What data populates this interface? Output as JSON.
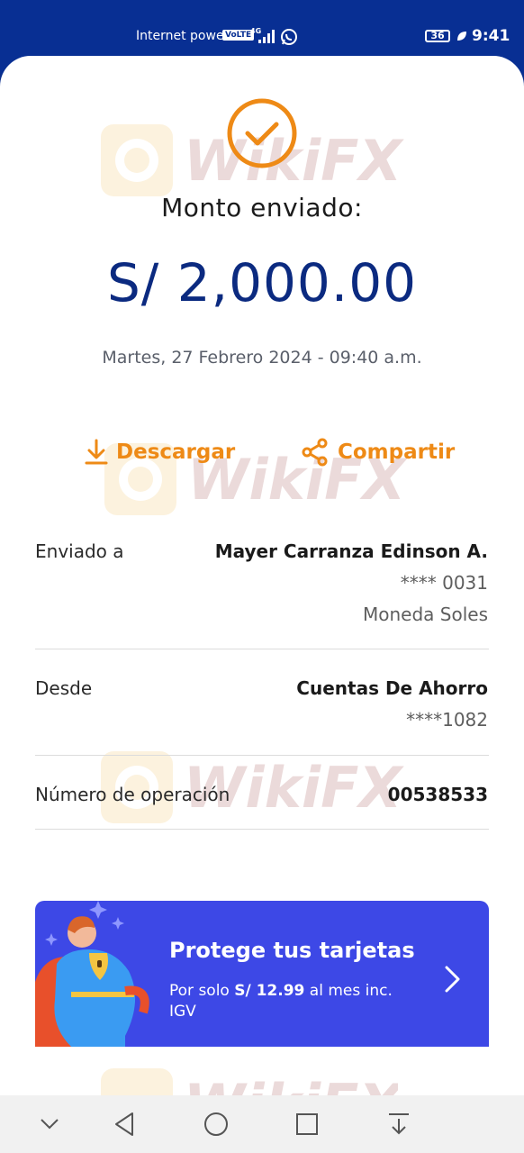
{
  "status_bar": {
    "carrier": "Internet power",
    "volte": "VoLTE",
    "network": "4G",
    "battery": "36",
    "time": "9:41"
  },
  "receipt": {
    "title": "Monto enviado:",
    "amount": "S/ 2,000.00",
    "datetime": "Martes, 27 Febrero 2024 - 09:40 a.m.",
    "download_label": "Descargar",
    "share_label": "Compartir"
  },
  "details": {
    "sent_to_label": "Enviado a",
    "recipient_name": "Mayer Carranza Edinson A.",
    "recipient_account": "**** 0031",
    "recipient_currency": "Moneda Soles",
    "from_label": "Desde",
    "from_account_type": "Cuentas De Ahorro",
    "from_account": "****1082",
    "operation_label": "Número de operación",
    "operation_number": "00538533"
  },
  "banner": {
    "title": "Protege tus tarjetas",
    "subtitle_prefix": "Por solo ",
    "subtitle_price": "S/ 12.99",
    "subtitle_suffix": " al mes inc. IGV"
  },
  "watermark": {
    "text": "WikiFX"
  },
  "colors": {
    "status_bar": "#082f93",
    "accent_orange": "#ee8a16",
    "amount_blue": "#0b2a80",
    "banner_blue": "#3d48e6"
  },
  "icons": {
    "check": "check-circle-icon",
    "download": "download-icon",
    "share": "share-icon",
    "banner_arrow": "chevron-right-icon"
  }
}
